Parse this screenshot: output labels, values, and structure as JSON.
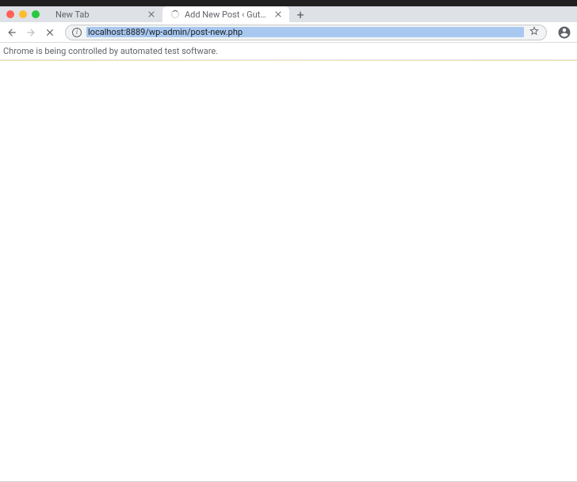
{
  "tabs": [
    {
      "title": "New Tab",
      "active": false
    },
    {
      "title": "Add New Post ‹ Gutenberg Te…",
      "active": true,
      "loading": true
    }
  ],
  "toolbar": {
    "new_tab_glyph": "+"
  },
  "omnibox": {
    "info_glyph": "i",
    "url": "localhost:8889/wp-admin/post-new.php"
  },
  "infobar": {
    "message": "Chrome is being controlled by automated test software."
  }
}
